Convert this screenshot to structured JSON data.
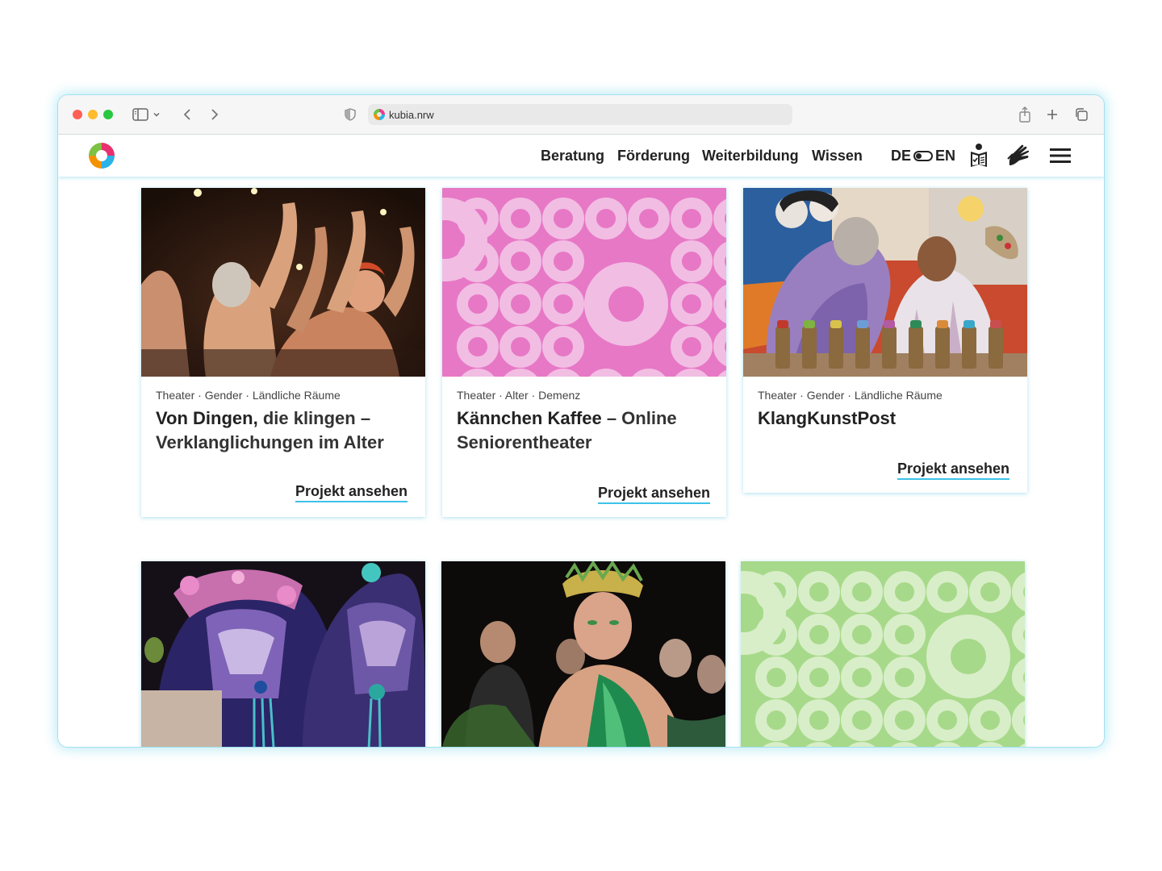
{
  "browser": {
    "url": "kubia.nrw"
  },
  "nav": {
    "items": [
      "Beratung",
      "Förderung",
      "Weiterbildung",
      "Wissen"
    ],
    "lang_de": "DE",
    "lang_en": "EN"
  },
  "cards": [
    {
      "tags": "Theater · Gender · Ländliche Räume",
      "title_strong": "Von Dingen,",
      "title_rest": " die klingen – Verklanglichungen im Alter",
      "link": "Projekt ansehen",
      "image": "photo-dancers"
    },
    {
      "tags": "Theater · Alter · Demenz",
      "title_strong": "Kännchen Kaffee",
      "title_rest": " – Online Seniorentheater",
      "link": "Projekt ansehen",
      "image": "pattern-pink"
    },
    {
      "tags": "Theater · Gender · Ländliche Räume",
      "title_strong": "KlangKunstPost",
      "title_rest": "",
      "link": "Projekt ansehen",
      "image": "photo-painting"
    },
    {
      "image": "photo-masks"
    },
    {
      "image": "photo-performer"
    },
    {
      "image": "pattern-green"
    }
  ],
  "colors": {
    "accent_underline": "#3ec2e8",
    "pink_bg": "#e778c6",
    "pink_shape": "#f2bde3",
    "green_bg": "#a7d98a",
    "green_shape": "#d8eec8"
  }
}
